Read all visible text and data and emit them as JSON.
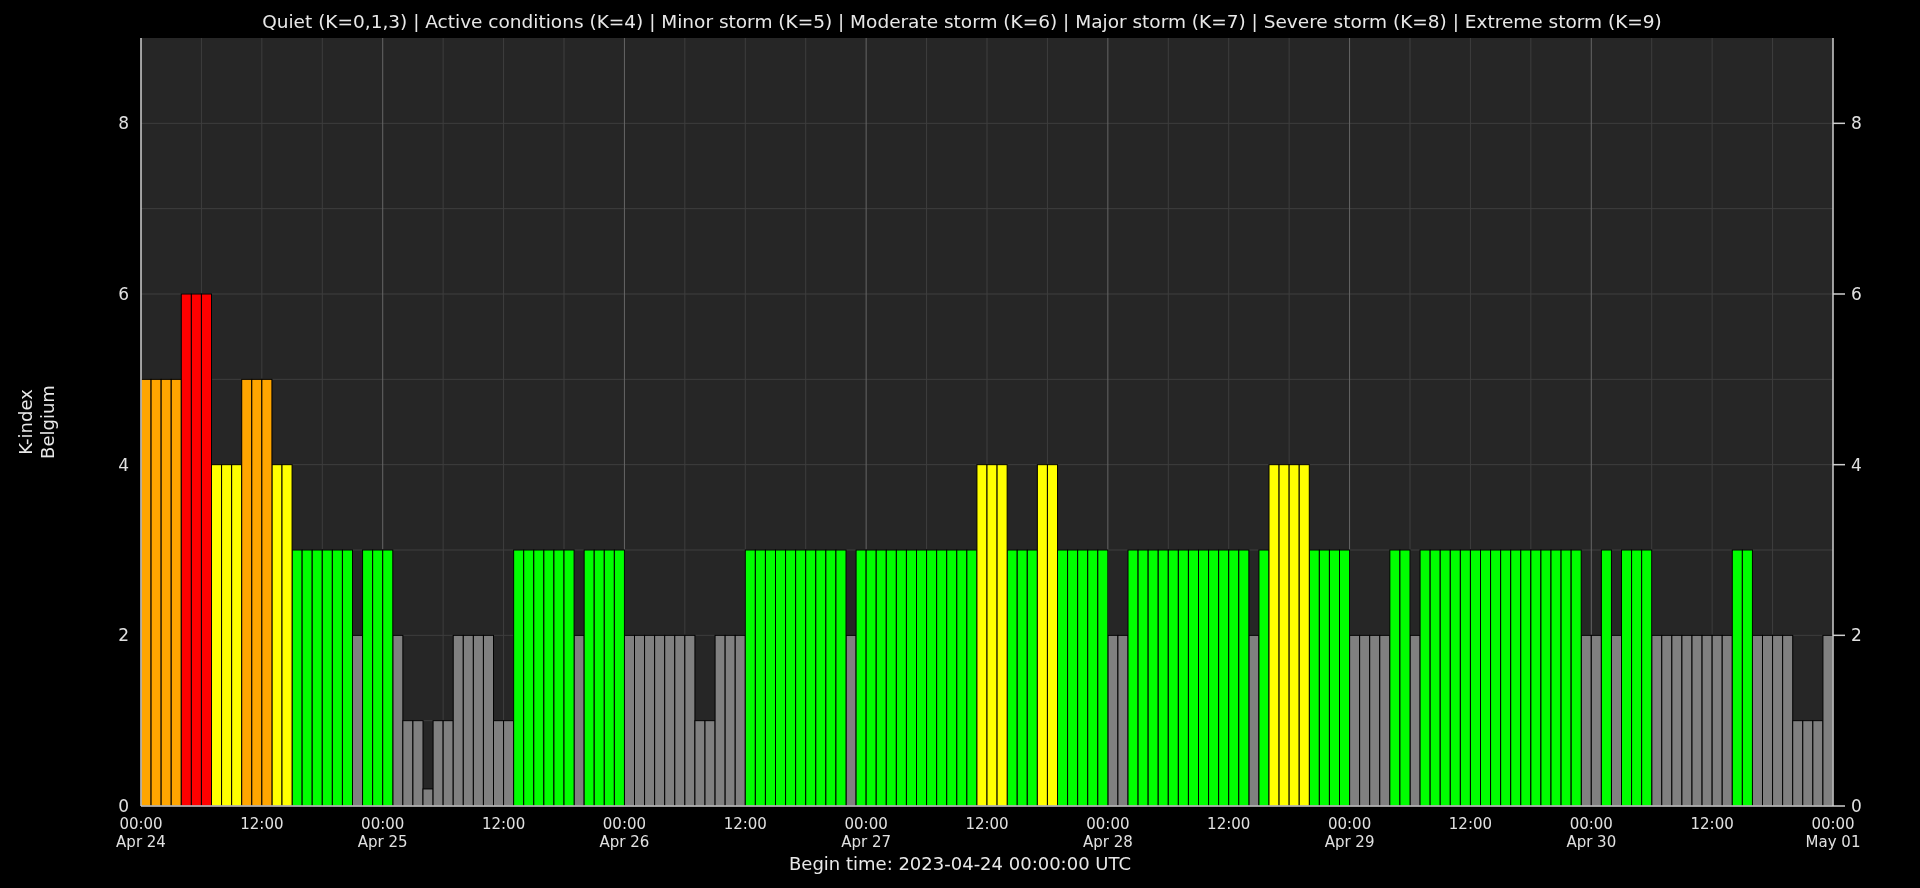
{
  "chart": {
    "chart_data": {
      "type": "bar",
      "title": "Quiet (K=0,1,3) | Active conditions (K=4) | Minor storm (K=5) | Moderate storm (K=6) | Major storm (K=7) | Severe storm (K=8) | Extreme storm (K=9)",
      "xlabel": "Begin time: 2023-04-24 00:00:00 UTC",
      "ylabel": "K-index\nBelgium",
      "grid": true,
      "ylim": [
        0,
        9
      ],
      "y2lim": [
        0,
        9
      ],
      "yticks": [
        0,
        2,
        4,
        6,
        8
      ],
      "y2ticks": [
        0,
        2,
        4,
        6,
        8
      ],
      "categories": [
        "00:00\nApr 24",
        null,
        null,
        null,
        null,
        null,
        null,
        null,
        null,
        null,
        null,
        null,
        "12:00",
        null,
        null,
        null,
        null,
        null,
        null,
        null,
        null,
        null,
        null,
        null,
        "00:00\nApr 25",
        null,
        null,
        null,
        null,
        null,
        null,
        null,
        null,
        null,
        null,
        null,
        "12:00",
        null,
        null,
        null,
        null,
        null,
        null,
        null,
        null,
        null,
        null,
        null,
        "00:00\nApr 26",
        null,
        null,
        null,
        null,
        null,
        null,
        null,
        null,
        null,
        null,
        null,
        "12:00",
        null,
        null,
        null,
        null,
        null,
        null,
        null,
        null,
        null,
        null,
        null,
        "00:00\nApr 27",
        null,
        null,
        null,
        null,
        null,
        null,
        null,
        null,
        null,
        null,
        null,
        "12:00",
        null,
        null,
        null,
        null,
        null,
        null,
        null,
        null,
        null,
        null,
        null,
        "00:00\nApr 28",
        null,
        null,
        null,
        null,
        null,
        null,
        null,
        null,
        null,
        null,
        null,
        "12:00",
        null,
        null,
        null,
        null,
        null,
        null,
        null,
        null,
        null,
        null,
        null,
        "00:00\nApr 29",
        null,
        null,
        null,
        null,
        null,
        null,
        null,
        null,
        null,
        null,
        null,
        "12:00",
        null,
        null,
        null,
        null,
        null,
        null,
        null,
        null,
        null,
        null,
        null,
        "00:00\nApr 30",
        null,
        null,
        null,
        null,
        null,
        null,
        null,
        null,
        null,
        null,
        null,
        "12:00",
        null,
        null,
        null,
        null,
        null,
        null,
        null,
        null,
        null,
        null,
        null,
        "00:00\nMay 01"
      ],
      "series": [
        {
          "color": "#808080",
          "values": [
            null,
            null,
            null,
            null,
            null,
            null,
            null,
            null,
            null,
            null,
            null,
            null,
            null,
            null,
            null,
            null,
            null,
            null,
            null,
            null,
            null,
            2,
            null,
            null,
            null,
            2,
            1,
            1,
            0.2,
            1,
            1,
            2,
            2,
            2,
            2,
            1,
            1,
            null,
            null,
            null,
            null,
            null,
            null,
            2,
            null,
            null,
            null,
            null,
            2,
            2,
            2,
            2,
            2,
            2,
            2,
            1,
            1,
            2,
            2,
            2,
            null,
            null,
            null,
            null,
            null,
            null,
            null,
            null,
            null,
            null,
            2,
            null,
            null,
            null,
            null,
            null,
            null,
            null,
            null,
            null,
            null,
            null,
            null,
            null,
            null,
            null,
            null,
            null,
            null,
            null,
            null,
            null,
            null,
            null,
            null,
            null,
            2,
            2,
            null,
            null,
            null,
            null,
            null,
            null,
            null,
            null,
            null,
            null,
            null,
            null,
            2,
            null,
            null,
            null,
            null,
            null,
            null,
            null,
            null,
            null,
            2,
            2,
            2,
            2,
            null,
            null,
            2,
            null,
            null,
            null,
            null,
            null,
            null,
            null,
            null,
            null,
            null,
            null,
            null,
            null,
            null,
            null,
            null,
            2,
            2,
            null,
            2,
            null,
            null,
            null,
            2,
            2,
            2,
            2,
            2,
            2,
            2,
            2,
            null,
            null,
            2,
            2,
            2,
            2,
            1,
            1,
            1,
            2,
            null
          ]
        },
        {
          "color": "#00ff00",
          "values": [
            null,
            null,
            null,
            null,
            null,
            null,
            null,
            null,
            null,
            null,
            null,
            null,
            null,
            null,
            null,
            3,
            3,
            3,
            3,
            3,
            3,
            null,
            3,
            3,
            3,
            null,
            null,
            null,
            null,
            null,
            null,
            null,
            null,
            null,
            null,
            null,
            null,
            3,
            3,
            3,
            3,
            3,
            3,
            null,
            3,
            3,
            3,
            3,
            null,
            null,
            null,
            null,
            null,
            null,
            null,
            null,
            null,
            null,
            null,
            null,
            3,
            3,
            3,
            3,
            3,
            3,
            3,
            3,
            3,
            3,
            null,
            3,
            3,
            3,
            3,
            3,
            3,
            3,
            3,
            3,
            3,
            3,
            3,
            null,
            null,
            null,
            3,
            3,
            3,
            null,
            null,
            3,
            3,
            3,
            3,
            3,
            null,
            null,
            3,
            3,
            3,
            3,
            3,
            3,
            3,
            3,
            3,
            3,
            3,
            3,
            null,
            3,
            null,
            null,
            null,
            null,
            3,
            3,
            3,
            3,
            null,
            null,
            null,
            null,
            3,
            3,
            null,
            3,
            3,
            3,
            3,
            3,
            3,
            3,
            3,
            3,
            3,
            3,
            3,
            3,
            3,
            3,
            3,
            null,
            null,
            3,
            null,
            3,
            3,
            3,
            null,
            null,
            null,
            null,
            null,
            null,
            null,
            null,
            3,
            3,
            null,
            null,
            null,
            null,
            null,
            null,
            null,
            null,
            null
          ]
        },
        {
          "color": "#ffff00",
          "values": [
            null,
            null,
            null,
            null,
            null,
            null,
            null,
            4,
            4,
            4,
            null,
            null,
            null,
            4,
            4,
            null,
            null,
            null,
            null,
            null,
            null,
            null,
            null,
            null,
            null,
            null,
            null,
            null,
            null,
            null,
            null,
            null,
            null,
            null,
            null,
            null,
            null,
            null,
            null,
            null,
            null,
            null,
            null,
            null,
            null,
            null,
            null,
            null,
            null,
            null,
            null,
            null,
            null,
            null,
            null,
            null,
            null,
            null,
            null,
            null,
            null,
            null,
            null,
            null,
            null,
            null,
            null,
            null,
            null,
            null,
            null,
            null,
            null,
            null,
            null,
            null,
            null,
            null,
            null,
            null,
            null,
            null,
            null,
            4,
            4,
            4,
            null,
            null,
            null,
            4,
            4,
            null,
            null,
            null,
            null,
            null,
            null,
            null,
            null,
            null,
            null,
            null,
            null,
            null,
            null,
            null,
            null,
            null,
            null,
            null,
            null,
            null,
            4,
            4,
            4,
            4,
            null,
            null,
            null,
            null,
            null,
            null,
            null,
            null,
            null,
            null,
            null,
            null,
            null,
            null,
            null,
            null,
            null,
            null,
            null,
            null,
            null,
            null,
            null,
            null,
            null,
            null,
            null,
            null,
            null,
            null,
            null,
            null,
            null,
            null,
            null,
            null,
            null,
            null,
            null,
            null,
            null,
            null,
            null,
            null,
            null,
            null,
            null,
            null,
            null,
            null,
            null,
            null,
            null
          ]
        },
        {
          "color": "#ffa500",
          "values": [
            5,
            5,
            5,
            5,
            null,
            null,
            null,
            null,
            null,
            null,
            5,
            5,
            5,
            null,
            null,
            null,
            null,
            null,
            null,
            null,
            null,
            null,
            null,
            null,
            null,
            null,
            null,
            null,
            null,
            null,
            null,
            null,
            null,
            null,
            null,
            null,
            null,
            null,
            null,
            null,
            null,
            null,
            null,
            null,
            null,
            null,
            null,
            null,
            null,
            null,
            null,
            null,
            null,
            null,
            null,
            null,
            null,
            null,
            null,
            null,
            null,
            null,
            null,
            null,
            null,
            null,
            null,
            null,
            null,
            null,
            null,
            null,
            null,
            null,
            null,
            null,
            null,
            null,
            null,
            null,
            null,
            null,
            null,
            null,
            null,
            null,
            null,
            null,
            null,
            null,
            null,
            null,
            null,
            null,
            null,
            null,
            null,
            null,
            null,
            null,
            null,
            null,
            null,
            null,
            null,
            null,
            null,
            null,
            null,
            null,
            null,
            null,
            null,
            null,
            null,
            null,
            null,
            null,
            null,
            null,
            null,
            null,
            null,
            null,
            null,
            null,
            null,
            null,
            null,
            null,
            null,
            null,
            null,
            null,
            null,
            null,
            null,
            null,
            null,
            null,
            null,
            null,
            null,
            null,
            null,
            null,
            null,
            null,
            null,
            null,
            null,
            null,
            null,
            null,
            null,
            null,
            null,
            null,
            null,
            null,
            null,
            null,
            null,
            null,
            null,
            null,
            null,
            null,
            null
          ]
        },
        {
          "color": "#ff0000",
          "values": [
            null,
            null,
            null,
            null,
            6,
            6,
            6,
            null,
            null,
            null,
            null,
            null,
            null,
            null,
            null,
            null,
            null,
            null,
            null,
            null,
            null,
            null,
            null,
            null,
            null,
            null,
            null,
            null,
            null,
            null,
            null,
            null,
            null,
            null,
            null,
            null,
            null,
            null,
            null,
            null,
            null,
            null,
            null,
            null,
            null,
            null,
            null,
            null,
            null,
            null,
            null,
            null,
            null,
            null,
            null,
            null,
            null,
            null,
            null,
            null,
            null,
            null,
            null,
            null,
            null,
            null,
            null,
            null,
            null,
            null,
            null,
            null,
            null,
            null,
            null,
            null,
            null,
            null,
            null,
            null,
            null,
            null,
            null,
            null,
            null,
            null,
            null,
            null,
            null,
            null,
            null,
            null,
            null,
            null,
            null,
            null,
            null,
            null,
            null,
            null,
            null,
            null,
            null,
            null,
            null,
            null,
            null,
            null,
            null,
            null,
            null,
            null,
            null,
            null,
            null,
            null,
            null,
            null,
            null,
            null,
            null,
            null,
            null,
            null,
            null,
            null,
            null,
            null,
            null,
            null,
            null,
            null,
            null,
            null,
            null,
            null,
            null,
            null,
            null,
            null,
            null,
            null,
            null,
            null,
            null,
            null,
            null,
            null,
            null,
            null,
            null,
            null,
            null,
            null,
            null,
            null,
            null,
            null,
            null,
            null,
            null,
            null,
            null,
            null,
            null,
            null,
            null,
            null,
            null
          ]
        }
      ]
    }
  }
}
